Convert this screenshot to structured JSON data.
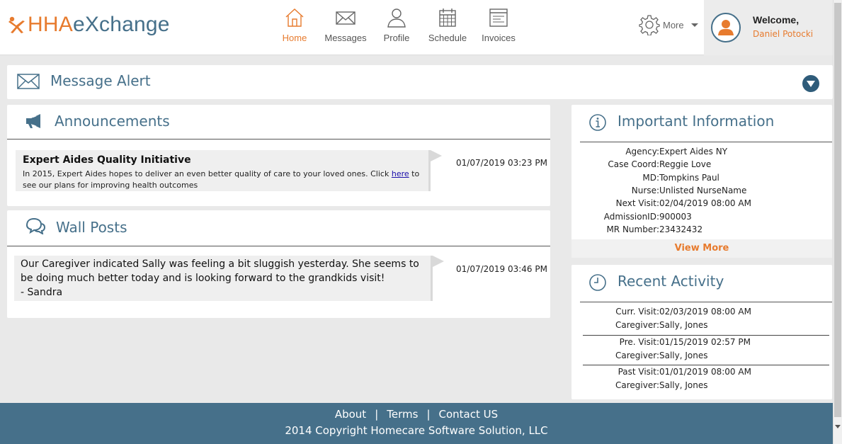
{
  "brand": {
    "logo_part1": "HHA",
    "logo_part2": "eXchange",
    "accent": "#e77b2e",
    "primary": "#46708a"
  },
  "nav": {
    "items": [
      {
        "label": "Home",
        "icon": "home-icon",
        "active": true
      },
      {
        "label": "Messages",
        "icon": "envelope-icon"
      },
      {
        "label": "Profile",
        "icon": "person-icon"
      },
      {
        "label": "Schedule",
        "icon": "calendar-icon"
      },
      {
        "label": "Invoices",
        "icon": "invoice-icon"
      }
    ],
    "more_label": "More"
  },
  "user": {
    "welcome": "Welcome,",
    "name": "Daniel Potocki"
  },
  "message_alert": {
    "title": "Message Alert"
  },
  "announcements": {
    "title": "Announcements",
    "items": [
      {
        "heading": "Expert Aides Quality Initiative",
        "text_before": "In 2015, Expert Aides hopes to deliver an even better quality of care to your loved ones.  Click ",
        "link": "here",
        "text_after": " to see our plans for improving health outcomes",
        "timestamp": "01/07/2019 03:23 PM"
      }
    ]
  },
  "wall_posts": {
    "title": "Wall Posts",
    "items": [
      {
        "line1": "Our Caregiver indicated Sally was feeling a bit sluggish yesterday.  She seems to",
        "line2": "be doing much better today and is looking forward to the grandkids visit!",
        "line3": "- Sandra",
        "timestamp": "01/07/2019 03:46 PM"
      }
    ]
  },
  "important_info": {
    "title": "Important Information",
    "rows": [
      {
        "label": "Agency:",
        "value": "Expert Aides NY"
      },
      {
        "label": "Case Coord:",
        "value": "Reggie Love"
      },
      {
        "label": "MD:",
        "value": "Tompkins Paul"
      },
      {
        "label": "Nurse:",
        "value": "Unlisted NurseName"
      },
      {
        "label": "Next Visit:",
        "value": "02/04/2019 08:00 AM"
      },
      {
        "label": "AdmissionID:",
        "value": "900003"
      },
      {
        "label": "MR Number:",
        "value": "23432432"
      }
    ],
    "view_more": "View More"
  },
  "recent_activity": {
    "title": "Recent Activity",
    "groups": [
      {
        "visit_label": "Curr. Visit:",
        "visit_value": "02/03/2019 08:00 AM",
        "cg_label": "Caregiver:",
        "cg_value": "Sally, Jones"
      },
      {
        "visit_label": "Pre. Visit:",
        "visit_value": "01/15/2019 02:57 PM",
        "cg_label": "Caregiver:",
        "cg_value": "Sally, Jones"
      },
      {
        "visit_label": "Past Visit:",
        "visit_value": "01/01/2019 08:00 AM",
        "cg_label": "Caregiver:",
        "cg_value": "Sally, Jones"
      }
    ]
  },
  "footer": {
    "links": [
      "About",
      "Terms",
      "Contact US"
    ],
    "separator": "|",
    "copyright": "2014 Copyright Homecare Software Solution, LLC"
  }
}
